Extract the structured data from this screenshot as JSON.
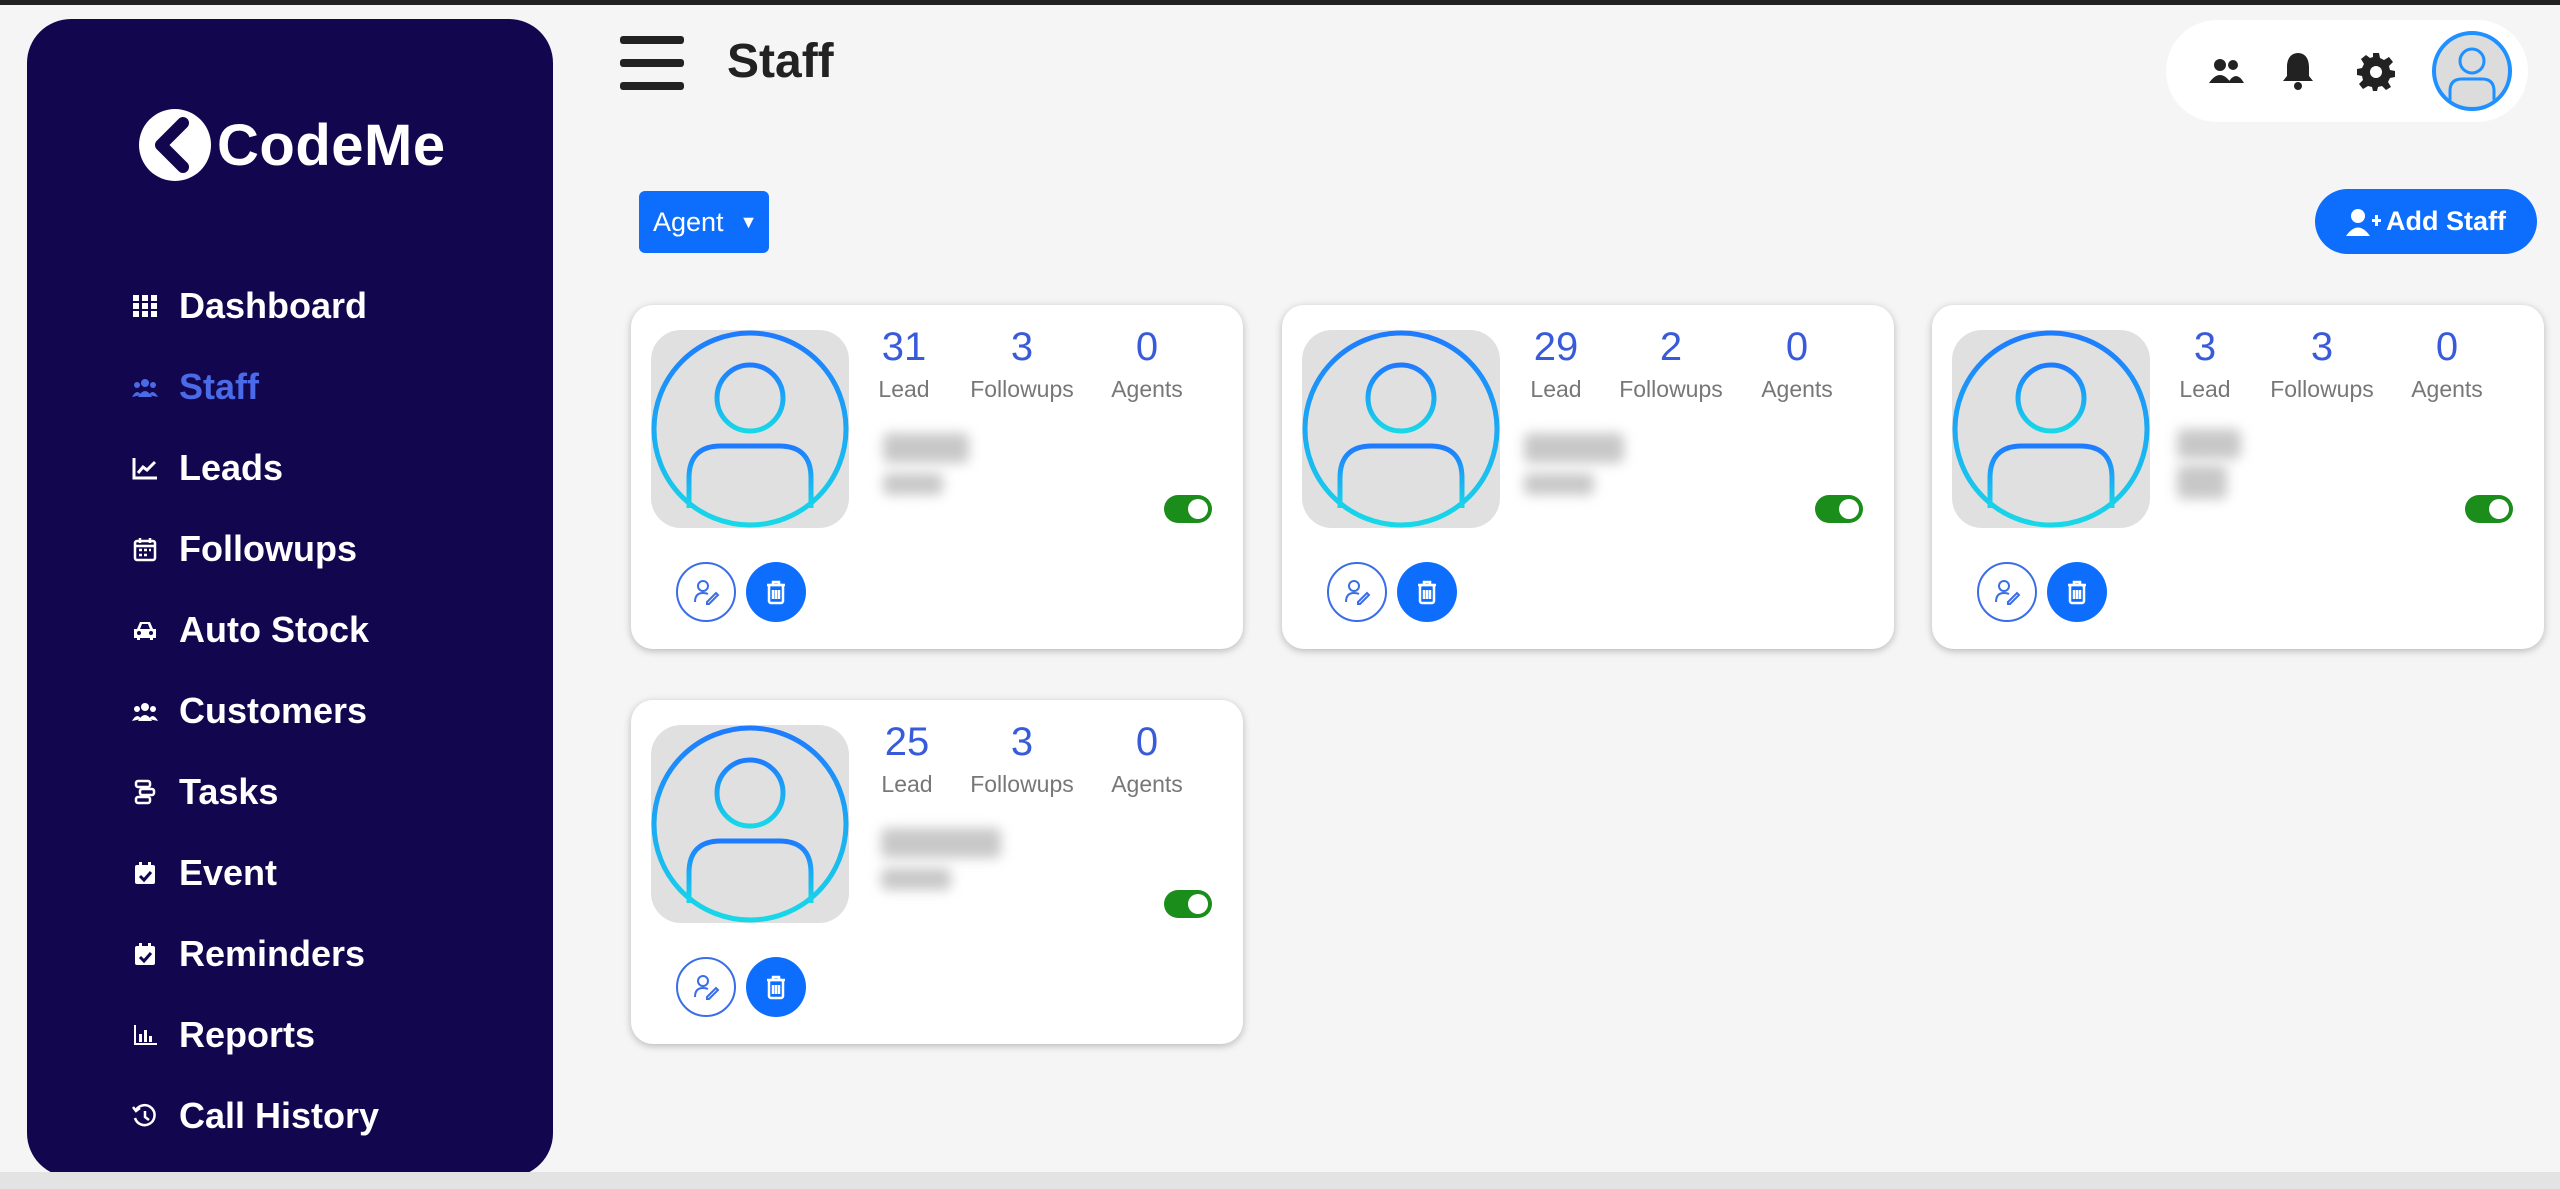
{
  "app": {
    "logo_text": "CodeMe"
  },
  "sidebar": {
    "items": [
      {
        "label": "Dashboard",
        "icon": "grid-icon",
        "active": false
      },
      {
        "label": "Staff",
        "icon": "users-icon",
        "active": true
      },
      {
        "label": "Leads",
        "icon": "chart-line-icon",
        "active": false
      },
      {
        "label": "Followups",
        "icon": "calendar-icon",
        "active": false
      },
      {
        "label": "Auto Stock",
        "icon": "car-icon",
        "active": false
      },
      {
        "label": "Customers",
        "icon": "users-icon",
        "active": false
      },
      {
        "label": "Tasks",
        "icon": "tasks-icon",
        "active": false
      },
      {
        "label": "Event",
        "icon": "calendar-check-icon",
        "active": false
      },
      {
        "label": "Reminders",
        "icon": "calendar-check-icon",
        "active": false
      },
      {
        "label": "Reports",
        "icon": "bar-chart-icon",
        "active": false
      },
      {
        "label": "Call History",
        "icon": "history-icon",
        "active": false
      }
    ]
  },
  "header": {
    "title": "Staff",
    "tools": [
      "users-icon",
      "bell-icon",
      "gear-icon",
      "avatar"
    ]
  },
  "filter": {
    "selected": "Agent"
  },
  "actions": {
    "add_staff_label": "Add Staff"
  },
  "stat_labels": {
    "lead": "Lead",
    "followups": "Followups",
    "agents": "Agents"
  },
  "staff": [
    {
      "lead": "31",
      "followups": "3",
      "agents": "0",
      "active": true
    },
    {
      "lead": "29",
      "followups": "2",
      "agents": "0",
      "active": true
    },
    {
      "lead": "3",
      "followups": "3",
      "agents": "0",
      "active": true
    },
    {
      "lead": "25",
      "followups": "3",
      "agents": "0",
      "active": true
    }
  ],
  "colors": {
    "sidebar_bg": "#12074f",
    "active_nav": "#4b6ae8",
    "primary": "#0d6efd",
    "stat_value": "#3a5bd9",
    "toggle_on": "#1a8d1a"
  }
}
